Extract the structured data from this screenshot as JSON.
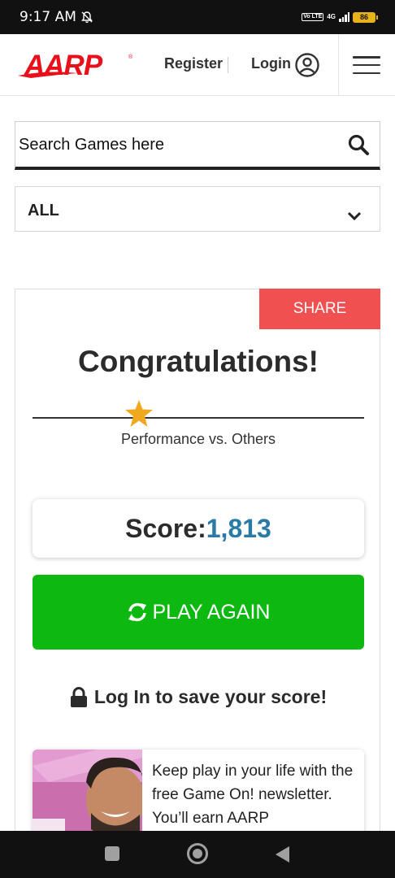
{
  "status_bar": {
    "time": "9:17 AM",
    "volte": "Vo LTE",
    "network": "4G",
    "battery": "86",
    "icons": [
      "bell-off-icon",
      "signal-icon",
      "battery-icon"
    ]
  },
  "header": {
    "logo_text": "AARP",
    "register": "Register",
    "login": "Login",
    "brand_color": "#e8111b"
  },
  "search": {
    "placeholder": "Search Games here"
  },
  "filter": {
    "selected": "ALL"
  },
  "result": {
    "share": "SHARE",
    "title": "Congratulations!",
    "performance_label": "Performance vs. Others",
    "performance_fraction": 0.32,
    "score_label": "Score:",
    "score_value": "1,813",
    "play_again": "PLAY AGAIN",
    "login_prompt": "Log In to save your score!"
  },
  "newsletter": {
    "text": "Keep play in your life with the free Game On! newsletter. You’ll earn AARP"
  },
  "colors": {
    "share_bg": "#f05050",
    "play_bg": "#0db810",
    "score_value": "#2a7aa6",
    "star": "#f0a81c"
  }
}
